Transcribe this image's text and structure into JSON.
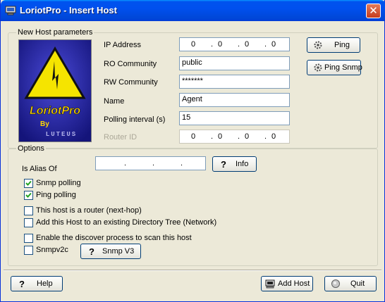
{
  "window": {
    "title": "LoriotPro - Insert Host",
    "close_glyph": "✕"
  },
  "host_params": {
    "legend": "New Host parameters",
    "ip_label": "IP Address",
    "ip": [
      "0",
      "0",
      "0",
      "0"
    ],
    "ro_label": "RO Community",
    "ro_value": "public",
    "rw_label": "RW Community",
    "rw_value": "*******",
    "name_label": "Name",
    "name_value": "Agent",
    "polling_label": "Polling interval (s)",
    "polling_value": "15",
    "router_label": "Router ID",
    "router_ip": [
      "0",
      "0",
      "0",
      "0"
    ],
    "ping_label": "Ping",
    "ping_snmp_label": "Ping Snmp"
  },
  "logo": {
    "brand": "LoriotPro",
    "by": "By",
    "maker": "LUTEUS",
    "colors": {
      "bg": "#2a2aa8",
      "triangle": "#f5e400",
      "text": "#ffd800"
    }
  },
  "options": {
    "legend": "Options",
    "alias_label": "Is Alias Of",
    "alias_ip": [
      "",
      "",
      "",
      ""
    ],
    "info_label": "Info",
    "snmp_polling": {
      "label": "Snmp polling",
      "checked": true
    },
    "ping_polling": {
      "label": "Ping polling",
      "checked": true
    },
    "router": {
      "label": "This host is a router (next-hop)",
      "checked": false
    },
    "add_tree": {
      "label": "Add this Host to an existing Directory Tree (Network)",
      "checked": false
    },
    "discover": {
      "label": "Enable the discover process to scan this host",
      "checked": false
    },
    "snmpv2c": {
      "label": "Snmpv2c",
      "checked": false
    },
    "snmpv3_label": "Snmp V3"
  },
  "footer": {
    "help_label": "Help",
    "add_host_label": "Add Host",
    "quit_label": "Quit"
  },
  "colors": {
    "titlebar": "#0053ee",
    "face": "#ece9d8",
    "field_border": "#7f9db9",
    "button_border": "#003c74"
  }
}
